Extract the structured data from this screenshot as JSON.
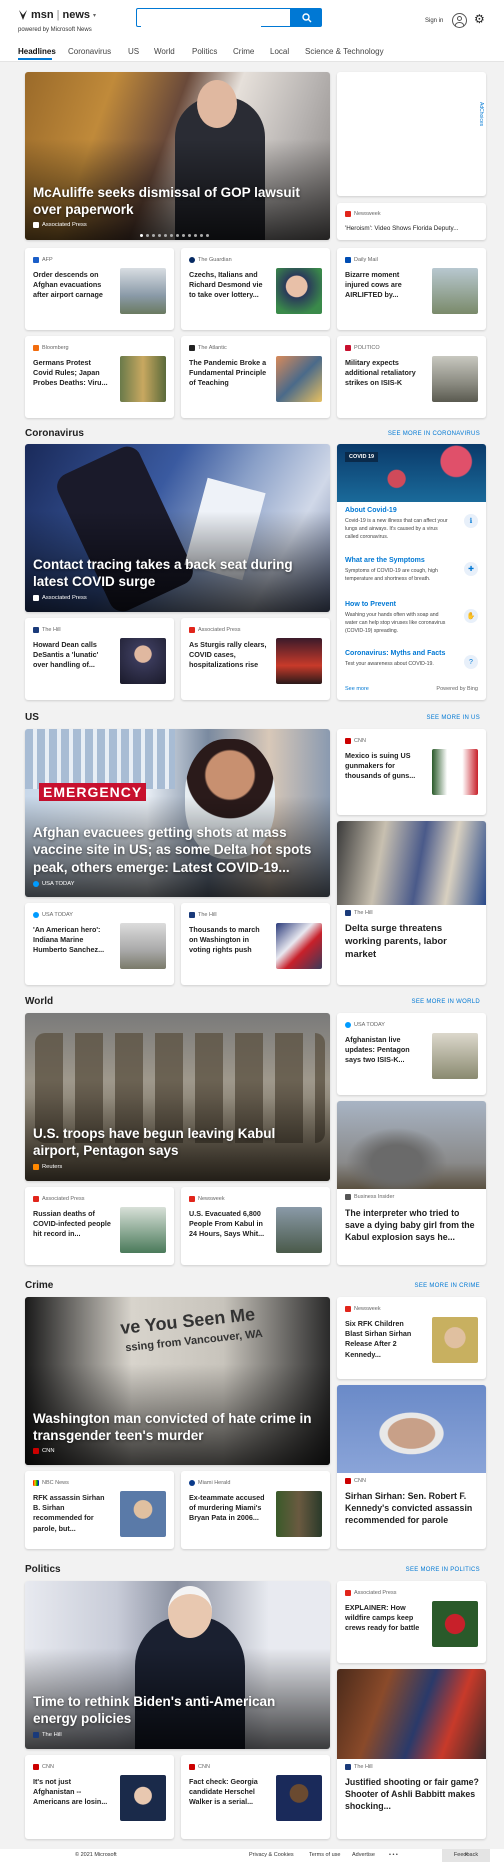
{
  "header": {
    "logo": "msn",
    "section": "news",
    "powered_by": "powered by Microsoft News",
    "search_placeholder": "",
    "signin": "Sign in"
  },
  "nav": [
    "Headlines",
    "Coronavirus",
    "US",
    "World",
    "Politics",
    "Crime",
    "Local",
    "Science & Technology"
  ],
  "ad_label": "AdChoices",
  "top": {
    "hero": {
      "title": "McAuliffe seeks dismissal of GOP lawsuit over paperwork",
      "source": "Associated Press"
    },
    "side": {
      "source": "Newsweek",
      "title": "'Heroism': Video Shows Florida Deputy..."
    },
    "row1": [
      {
        "source": "AFP",
        "title": "Order descends on Afghan evacuations after airport carnage"
      },
      {
        "source": "The Guardian",
        "title": "Czechs, Italians and Richard Desmond vie to take over lottery..."
      },
      {
        "source": "Daily Mail",
        "title": "Bizarre moment injured cows are AIRLIFTED by..."
      }
    ],
    "row2": [
      {
        "source": "Bloomberg",
        "title": "Germans Protest Covid Rules; Japan Probes Deaths: Viru..."
      },
      {
        "source": "The Atlantic",
        "title": "The Pandemic Broke a Fundamental Principle of Teaching"
      },
      {
        "source": "POLITICO",
        "title": "Military expects additional retaliatory strikes on ISIS-K"
      }
    ]
  },
  "coronavirus": {
    "heading": "Coronavirus",
    "see_more": "SEE MORE IN CORONAVIRUS",
    "hero": {
      "title": "Contact tracing takes a back seat during latest COVID surge",
      "source": "Associated Press"
    },
    "small": [
      {
        "source": "The Hill",
        "title": "Howard Dean calls DeSantis a 'lunatic' over handling of..."
      },
      {
        "source": "Associated Press",
        "title": "As Sturgis rally clears, COVID cases, hospitalizations rise"
      }
    ],
    "panel": {
      "badge": "COVID 19",
      "items": [
        {
          "title": "About Covid-19",
          "desc": "Covid-19 is a new illness that can affect your lungs and airways. It's caused by a virus called coronavirus."
        },
        {
          "title": "What are the Symptoms",
          "desc": "Symptoms of COVID-19 are cough, high temperature and shortness of breath."
        },
        {
          "title": "How to Prevent",
          "desc": "Washing your hands often with soap and water can help stop viruses like coronavirus (COVID-19) spreading."
        },
        {
          "title": "Coronavirus: Myths and Facts",
          "desc": "Test your awareness about COVID-19."
        }
      ],
      "see_more": "See more",
      "powered": "Powered by Bing"
    }
  },
  "us": {
    "heading": "US",
    "see_more": "SEE MORE IN US",
    "hero": {
      "title": "Afghan evacuees getting shots at mass vaccine site in US; as some Delta hot spots peak, others emerge: Latest COVID-19...",
      "source": "USA TODAY",
      "sign": "EMERGENCY"
    },
    "side": {
      "source": "CNN",
      "title": "Mexico is suing US gunmakers for thousands of guns..."
    },
    "tall": {
      "source": "The Hill",
      "title": "Delta surge threatens working parents, labor market"
    },
    "small": [
      {
        "source": "USA TODAY",
        "title": "'An American hero': Indiana Marine Humberto Sanchez..."
      },
      {
        "source": "The Hill",
        "title": "Thousands to march on Washington in voting rights push"
      }
    ]
  },
  "world": {
    "heading": "World",
    "see_more": "SEE MORE IN WORLD",
    "hero": {
      "title": "U.S. troops have begun leaving Kabul airport, Pentagon says",
      "source": "Reuters"
    },
    "side": {
      "source": "USA TODAY",
      "title": "Afghanistan live updates: Pentagon says two ISIS-K..."
    },
    "tall": {
      "source": "Business Insider",
      "title": "The interpreter who tried to save a dying baby girl from the Kabul explosion says he..."
    },
    "small": [
      {
        "source": "Associated Press",
        "title": "Russian deaths of COVID-infected people hit record in..."
      },
      {
        "source": "Newsweek",
        "title": "U.S. Evacuated 6,800 People From Kabul in 24 Hours, Says Whit..."
      }
    ]
  },
  "crime": {
    "heading": "Crime",
    "see_more": "SEE MORE IN CRIME",
    "hero": {
      "title": "Washington man convicted of hate crime in transgender teen's murder",
      "source": "CNN",
      "poster": "ve You Seen Me",
      "poster2": "ssing from Vancouver, WA"
    },
    "side": {
      "source": "Newsweek",
      "title": "Six RFK Children Blast Sirhan Sirhan Release After 2 Kennedy..."
    },
    "tall": {
      "source": "CNN",
      "title": "Sirhan Sirhan: Sen. Robert F. Kennedy's convicted assassin recommended for parole"
    },
    "small": [
      {
        "source": "NBC News",
        "title": "RFK assassin Sirhan B. Sirhan recommended for parole, but..."
      },
      {
        "source": "Miami Herald",
        "title": "Ex-teammate accused of murdering Miami's Bryan Pata in 2006..."
      }
    ]
  },
  "politics": {
    "heading": "Politics",
    "see_more": "SEE MORE IN POLITICS",
    "hero": {
      "title": "Time to rethink Biden's anti-American energy policies",
      "source": "The Hill"
    },
    "side": {
      "source": "Associated Press",
      "title": "EXPLAINER: How wildfire camps keep crews ready for battle"
    },
    "tall": {
      "source": "The Hill",
      "title": "Justified shooting or fair game? Shooter of Ashli Babbitt makes shocking..."
    },
    "small": [
      {
        "source": "CNN",
        "title": "It's not just Afghanistan -- Americans are losin..."
      },
      {
        "source": "CNN",
        "title": "Fact check: Georgia candidate Herschel Walker is a serial..."
      }
    ]
  },
  "footer": {
    "copyright": "© 2021 Microsoft",
    "privacy": "Privacy & Cookies",
    "terms": "Terms of use",
    "advertise": "Advertise",
    "more": "• • •",
    "feedback": "Feedback"
  }
}
